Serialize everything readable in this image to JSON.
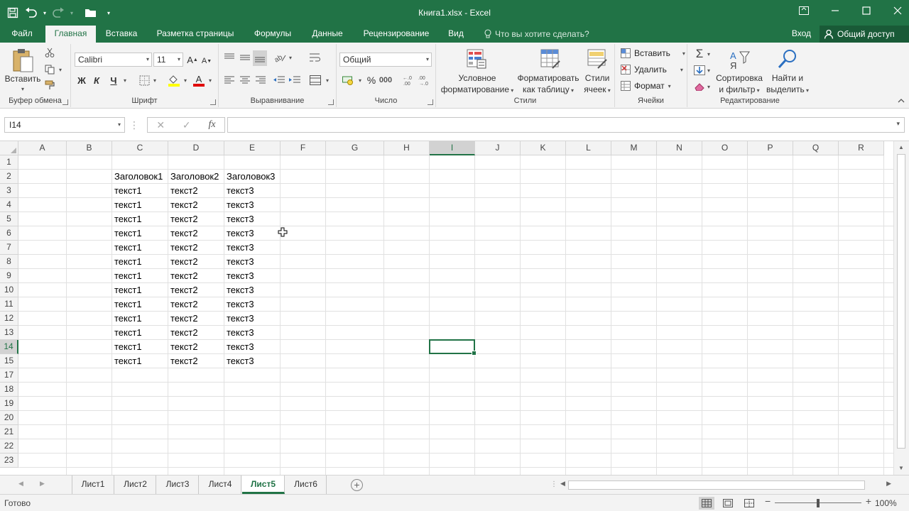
{
  "window": {
    "title": "Книга1.xlsx - Excel"
  },
  "menu": {
    "tabs": [
      "Файл",
      "Главная",
      "Вставка",
      "Разметка страницы",
      "Формулы",
      "Данные",
      "Рецензирование",
      "Вид"
    ],
    "active_tab": "Главная",
    "tell_me": "Что вы хотите сделать?",
    "login": "Вход",
    "share": "Общий доступ"
  },
  "ribbon": {
    "clipboard": {
      "label": "Буфер обмена",
      "paste": "Вставить"
    },
    "font": {
      "label": "Шрифт",
      "name": "Calibri",
      "size": "11",
      "bold": "Ж",
      "italic": "К",
      "underline": "Ч"
    },
    "alignment": {
      "label": "Выравнивание"
    },
    "number": {
      "label": "Число",
      "format": "Общий",
      "percent": "%"
    },
    "styles": {
      "label": "Стили",
      "conditional_1": "Условное",
      "conditional_2": "форматирование",
      "table_1": "Форматировать",
      "table_2": "как таблицу",
      "cell_1": "Стили",
      "cell_2": "ячеек"
    },
    "cells": {
      "label": "Ячейки",
      "insert": "Вставить",
      "delete": "Удалить",
      "format": "Формат"
    },
    "editing": {
      "label": "Редактирование",
      "sort_1": "Сортировка",
      "sort_2": "и фильтр",
      "find_1": "Найти и",
      "find_2": "выделить"
    }
  },
  "formula_bar": {
    "name_box": "I14",
    "fx": "fx",
    "content": ""
  },
  "sheet": {
    "columns": [
      "A",
      "B",
      "C",
      "D",
      "E",
      "F",
      "G",
      "H",
      "I",
      "J",
      "K",
      "L",
      "M",
      "N",
      "O",
      "P",
      "Q",
      "R"
    ],
    "rows": [
      "1",
      "2",
      "3",
      "4",
      "5",
      "6",
      "7",
      "8",
      "9",
      "10",
      "11",
      "12",
      "13",
      "14",
      "15",
      "17",
      "18",
      "19",
      "20",
      "21",
      "22",
      "23"
    ],
    "selected_column": "I",
    "selected_row": "14",
    "selected_cell": "I14",
    "header_row": {
      "row": "2",
      "values": [
        "Заголовок1",
        "Заголовок2",
        "Заголовок3"
      ]
    },
    "data_rows": [
      {
        "row": "3",
        "values": [
          "текст1",
          "текст2",
          "текст3"
        ]
      },
      {
        "row": "4",
        "values": [
          "текст1",
          "текст2",
          "текст3"
        ]
      },
      {
        "row": "5",
        "values": [
          "текст1",
          "текст2",
          "текст3"
        ]
      },
      {
        "row": "6",
        "values": [
          "текст1",
          "текст2",
          "текст3"
        ]
      },
      {
        "row": "7",
        "values": [
          "текст1",
          "текст2",
          "текст3"
        ]
      },
      {
        "row": "8",
        "values": [
          "текст1",
          "текст2",
          "текст3"
        ]
      },
      {
        "row": "9",
        "values": [
          "текст1",
          "текст2",
          "текст3"
        ]
      },
      {
        "row": "10",
        "values": [
          "текст1",
          "текст2",
          "текст3"
        ]
      },
      {
        "row": "11",
        "values": [
          "текст1",
          "текст2",
          "текст3"
        ]
      },
      {
        "row": "12",
        "values": [
          "текст1",
          "текст2",
          "текст3"
        ]
      },
      {
        "row": "13",
        "values": [
          "текст1",
          "текст2",
          "текст3"
        ]
      },
      {
        "row": "14",
        "values": [
          "текст1",
          "текст2",
          "текст3"
        ]
      },
      {
        "row": "15",
        "values": [
          "текст1",
          "текст2",
          "текст3"
        ]
      }
    ]
  },
  "sheet_tabs": {
    "tabs": [
      "Лист1",
      "Лист2",
      "Лист3",
      "Лист4",
      "Лист5",
      "Лист6"
    ],
    "active": "Лист5"
  },
  "status_bar": {
    "status": "Готово",
    "zoom": "100%"
  },
  "colors": {
    "accent": "#217346",
    "share_bg": "#195a37",
    "ribbon_bg": "#f3f3f3"
  }
}
